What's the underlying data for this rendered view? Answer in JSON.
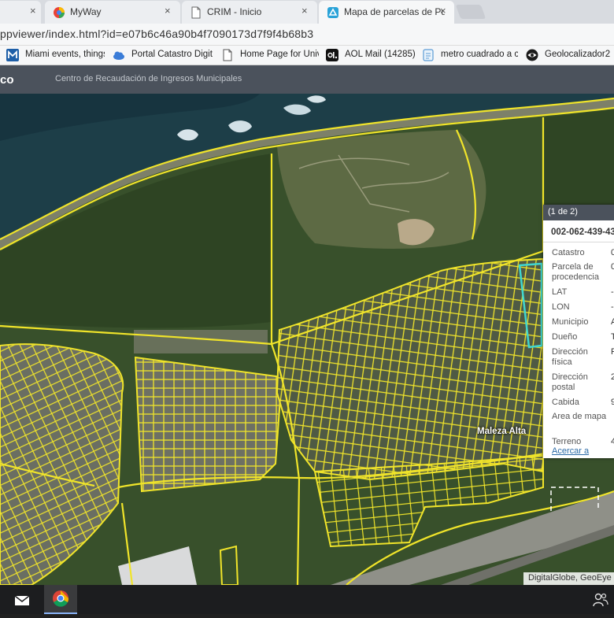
{
  "browser": {
    "tabs": [
      {
        "title": "",
        "active": false
      },
      {
        "title": "MyWay",
        "active": false
      },
      {
        "title": "CRIM - Inicio",
        "active": false
      },
      {
        "title": "Mapa de parcelas de Pue",
        "active": true
      }
    ],
    "close_glyph": "×",
    "url": "ppviewer/index.html?id=e07b6c46a90b4f7090173d7f9f4b68b3",
    "bookmarks": [
      {
        "label": "Miami events, things",
        "icon": "m-logo-icon"
      },
      {
        "label": "Portal Catastro Digit",
        "icon": "cloud-icon"
      },
      {
        "label": "Home Page for Unive",
        "icon": "page-icon"
      },
      {
        "label": "AOL Mail (14285)",
        "icon": "aol-icon"
      },
      {
        "label": "metro cuadrado a cu",
        "icon": "doc-icon"
      },
      {
        "label": "Geolocalizador2",
        "icon": "eye-icon"
      }
    ]
  },
  "app": {
    "name": "co",
    "subtitle": "Centro de Recaudación de Ingresos Municipales"
  },
  "map": {
    "place_label": "Maleza Alta",
    "attribution": "DigitalGlobe, GeoEye"
  },
  "popup": {
    "page": "(1 de 2)",
    "title": "002-062-439-43",
    "fields": [
      {
        "label": "Catastro",
        "value": "0"
      },
      {
        "label": "Parcela de procedencia",
        "value": "0"
      },
      {
        "label": "LAT",
        "value": "-"
      },
      {
        "label": "LON",
        "value": "-"
      },
      {
        "label": "Municipio",
        "value": "A"
      },
      {
        "label": "Dueño",
        "value": "T"
      },
      {
        "label": "Dirección física",
        "value": "F"
      },
      {
        "label": "Dirección postal",
        "value": "2"
      },
      {
        "label": "Cabida",
        "value": "9"
      },
      {
        "label": "Area de mapa",
        "value": ""
      },
      {
        "label": "Terreno",
        "value": "4"
      }
    ],
    "zoom_link": "Acercar a"
  },
  "colors": {
    "parcel_line": "#f0e42a",
    "selected_parcel": "#3fd6d0",
    "header_bg": "#4b525c"
  }
}
